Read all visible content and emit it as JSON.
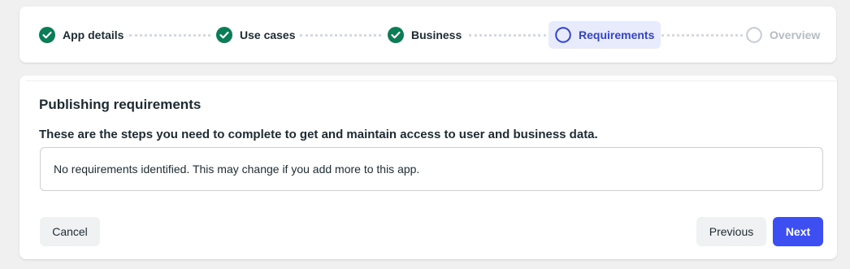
{
  "stepper": {
    "steps": [
      {
        "label": "App details",
        "status": "complete",
        "icon": "check-circle-icon"
      },
      {
        "label": "Use cases",
        "status": "complete",
        "icon": "check-circle-icon"
      },
      {
        "label": "Business",
        "status": "complete",
        "icon": "check-circle-icon"
      },
      {
        "label": "Requirements",
        "status": "active",
        "icon": "empty-circle-icon"
      },
      {
        "label": "Overview",
        "status": "pending",
        "icon": "empty-circle-icon"
      }
    ]
  },
  "main": {
    "title": "Publishing requirements",
    "subtitle": "These are the steps you need to complete to get and maintain access to user and business data.",
    "info_text": "No requirements identified. This may change if you add more to this app."
  },
  "footer": {
    "cancel_label": "Cancel",
    "previous_label": "Previous",
    "next_label": "Next"
  },
  "colors": {
    "complete": "#0a7d57",
    "active": "#3243cf",
    "pending": "#b4bcc4",
    "primary_button": "#3d4ff0"
  }
}
